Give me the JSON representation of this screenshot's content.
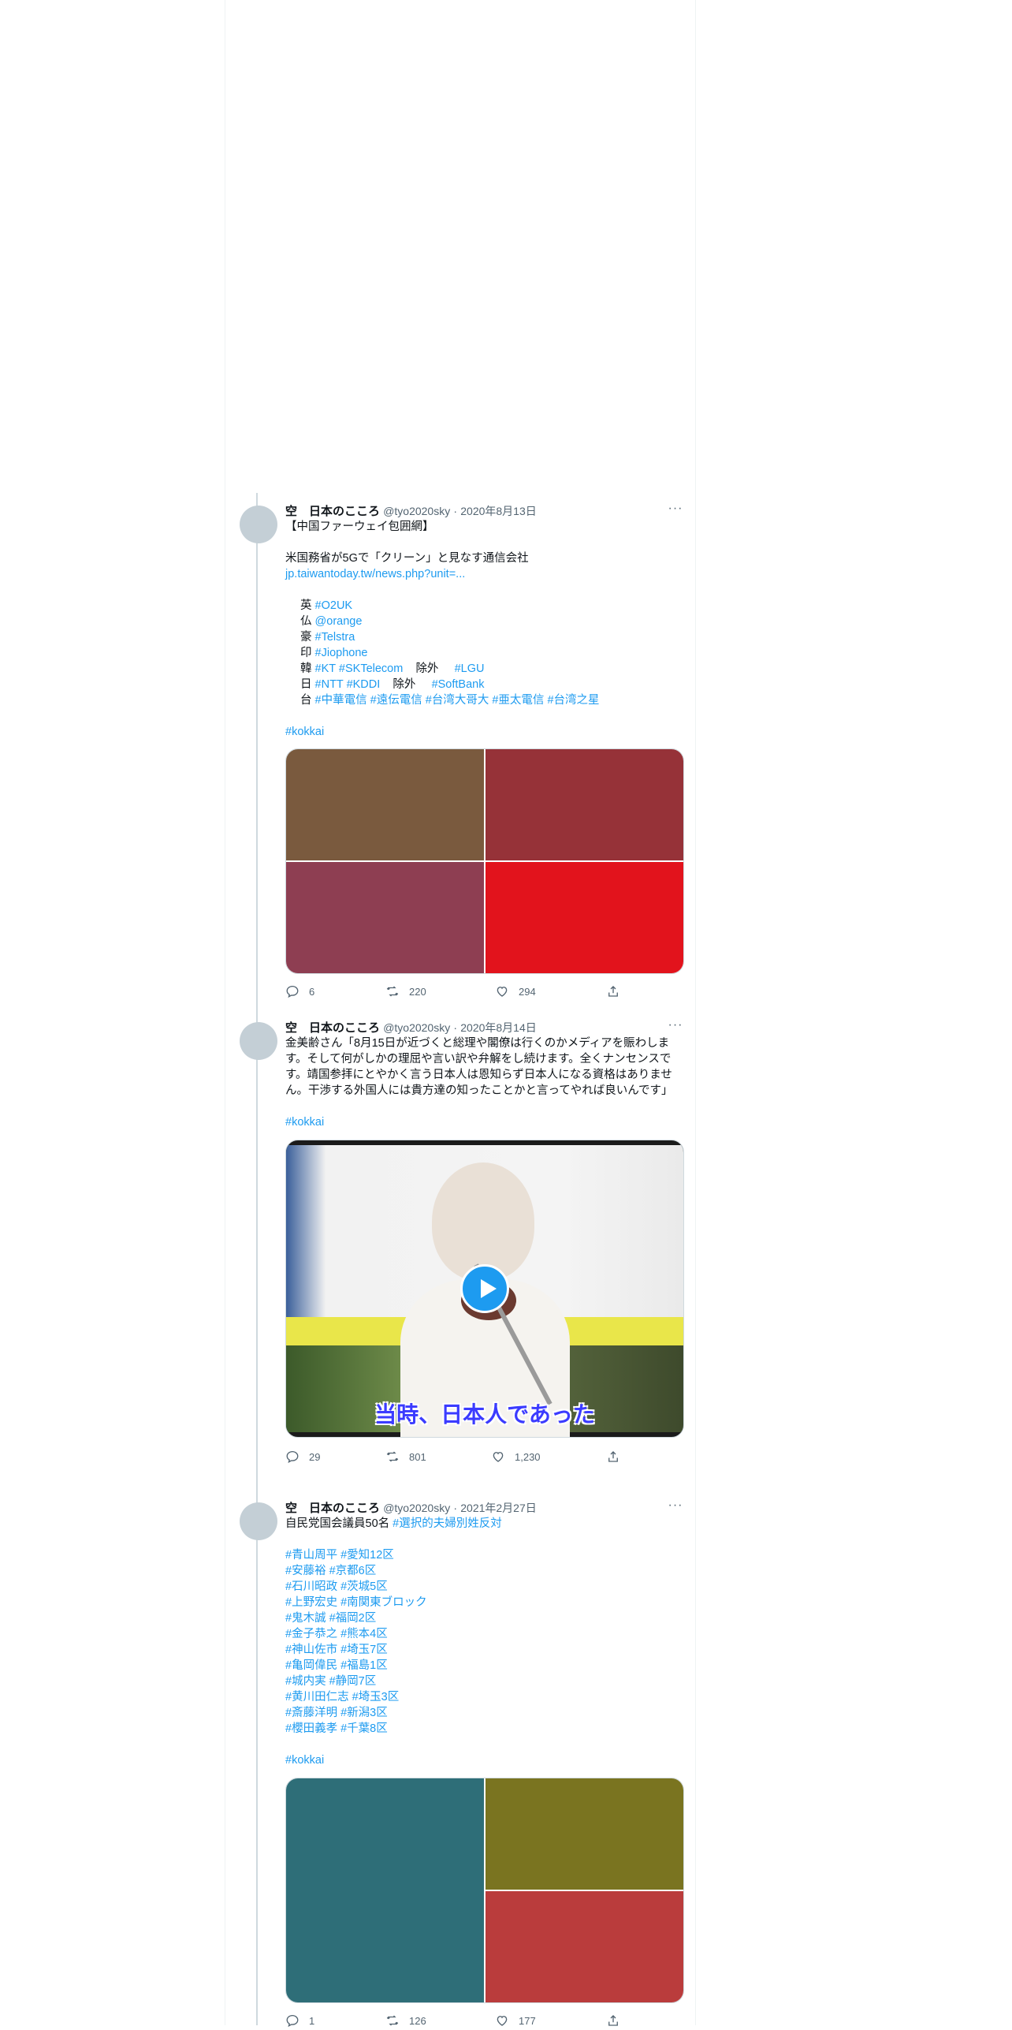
{
  "colors": {
    "link": "#1d9bf0",
    "muted": "#536471",
    "avatar": "#c4cfd6"
  },
  "tweets": [
    {
      "name": "空　日本のこころ",
      "handle": "@tyo2020sky",
      "dot": "·",
      "date": "2020年8月13日",
      "lines": [
        "【中国ファーウェイ包囲網】",
        "",
        "米国務省が5Gで「クリーン」と見なす通信会社"
      ],
      "link": "jp.taiwantoday.tw/news.php?unit=...",
      "carriers": [
        {
          "country": "英",
          "tags": [
            "#O2UK"
          ]
        },
        {
          "country": "仏",
          "tags": [
            "@orange"
          ]
        },
        {
          "country": "豪",
          "tags": [
            "#Telstra"
          ]
        },
        {
          "country": "印",
          "tags": [
            "#Jiophone"
          ]
        },
        {
          "country": "韓",
          "tags": [
            "#KT",
            "#SKTelecom"
          ],
          "exclude_label": "除外",
          "excluded": [
            "#LGU"
          ]
        },
        {
          "country": "日",
          "tags": [
            "#NTT",
            "#KDDI"
          ],
          "exclude_label": "除外",
          "excluded": [
            "#SoftBank"
          ]
        },
        {
          "country": "台",
          "tags": [
            "#中華電信",
            "#遠伝電信",
            "#台湾大哥大",
            "#亜太電信",
            "#台湾之星"
          ]
        }
      ],
      "footer_tag": "#kokkai",
      "media_colors": [
        "#7a5a3e",
        "#963238",
        "#8e3e52",
        "#e2131c"
      ],
      "stats": {
        "replies": "6",
        "retweets": "220",
        "likes": "294"
      }
    },
    {
      "name": "空　日本のこころ",
      "handle": "@tyo2020sky",
      "dot": "·",
      "date": "2020年8月14日",
      "paragraph": "金美齢さん「8月15日が近づくと総理や閣僚は行くのかメディアを賑わします。そして何がしかの理屈や言い訳や弁解をし続けます。全くナンセンスです。靖国参拝にとやかく言う日本人は恩知らず日本人になる資格はありません。干渉する外国人には貴方達の知ったことかと言ってやれば良いんです」",
      "footer_tag": "#kokkai",
      "video_caption": "当時、日本人であった",
      "stats": {
        "replies": "29",
        "retweets": "801",
        "likes": "1,230"
      }
    },
    {
      "name": "空　日本のこころ",
      "handle": "@tyo2020sky",
      "dot": "·",
      "date": "2021年2月27日",
      "first_line_text": "自民党国会議員50名",
      "first_line_tag": "#選択的夫婦別姓反対",
      "members": [
        [
          "#青山周平",
          "#愛知12区"
        ],
        [
          "#安藤裕",
          "#京都6区"
        ],
        [
          "#石川昭政",
          "#茨城5区"
        ],
        [
          "#上野宏史",
          "#南関東ブロック"
        ],
        [
          "#鬼木誠",
          "#福岡2区"
        ],
        [
          "#金子恭之",
          "#熊本4区"
        ],
        [
          "#神山佐市",
          "#埼玉7区"
        ],
        [
          "#亀岡偉民",
          "#福島1区"
        ],
        [
          "#城内実",
          "#静岡7区"
        ],
        [
          "#黄川田仁志",
          "#埼玉3区"
        ],
        [
          "#斎藤洋明",
          "#新潟3区"
        ],
        [
          "#櫻田義孝",
          "#千葉8区"
        ]
      ],
      "footer_tag": "#kokkai",
      "media_colors": [
        "#2e6e78",
        "#7a7420",
        "#ba3c3c"
      ],
      "stats": {
        "replies": "1",
        "retweets": "126",
        "likes": "177"
      }
    }
  ]
}
